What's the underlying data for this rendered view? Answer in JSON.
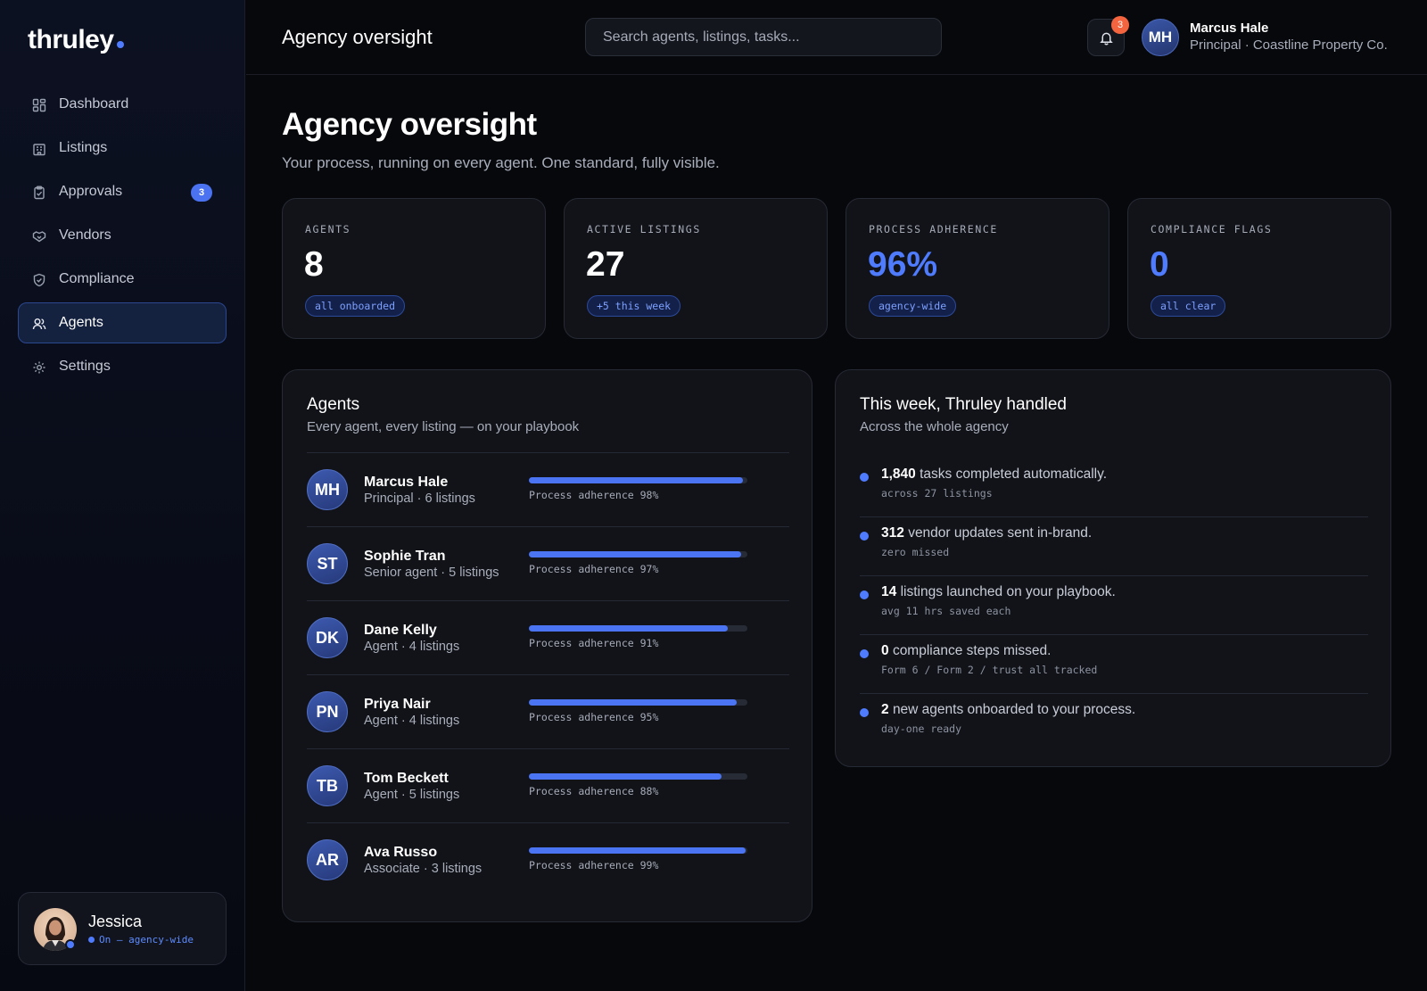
{
  "brand": {
    "name": "thruley"
  },
  "sidebar": {
    "items": [
      {
        "label": "Dashboard",
        "icon": "dashboard-icon"
      },
      {
        "label": "Listings",
        "icon": "building-icon"
      },
      {
        "label": "Approvals",
        "icon": "clipboard-icon",
        "badge": "3"
      },
      {
        "label": "Vendors",
        "icon": "handshake-icon"
      },
      {
        "label": "Compliance",
        "icon": "shield-icon"
      },
      {
        "label": "Agents",
        "icon": "users-icon",
        "active": true
      },
      {
        "label": "Settings",
        "icon": "gear-icon"
      }
    ],
    "assistant": {
      "name": "Jessica",
      "status": "On — agency-wide"
    }
  },
  "header": {
    "title": "Agency oversight",
    "search_placeholder": "Search agents, listings, tasks...",
    "notifications": "3",
    "user": {
      "initials": "MH",
      "name": "Marcus Hale",
      "role": "Principal · Coastline Property Co."
    }
  },
  "page": {
    "title": "Agency oversight",
    "subtitle": "Your process, running on every agent. One standard, fully visible."
  },
  "stats": [
    {
      "label": "AGENTS",
      "value": "8",
      "pill": "all onboarded"
    },
    {
      "label": "ACTIVE LISTINGS",
      "value": "27",
      "pill": "+5 this week"
    },
    {
      "label": "PROCESS ADHERENCE",
      "value": "96%",
      "pill": "agency-wide",
      "accent": true
    },
    {
      "label": "COMPLIANCE FLAGS",
      "value": "0",
      "pill": "all clear",
      "accent": true
    }
  ],
  "agents_panel": {
    "title": "Agents",
    "subtitle": "Every agent, every listing — on your playbook",
    "rows": [
      {
        "initials": "MH",
        "name": "Marcus Hale",
        "meta": "Principal · 6 listings",
        "adherence": 98,
        "label": "Process adherence 98%"
      },
      {
        "initials": "ST",
        "name": "Sophie Tran",
        "meta": "Senior agent · 5 listings",
        "adherence": 97,
        "label": "Process adherence 97%"
      },
      {
        "initials": "DK",
        "name": "Dane Kelly",
        "meta": "Agent · 4 listings",
        "adherence": 91,
        "label": "Process adherence 91%"
      },
      {
        "initials": "PN",
        "name": "Priya Nair",
        "meta": "Agent · 4 listings",
        "adherence": 95,
        "label": "Process adherence 95%"
      },
      {
        "initials": "TB",
        "name": "Tom Beckett",
        "meta": "Agent · 5 listings",
        "adherence": 88,
        "label": "Process adherence 88%"
      },
      {
        "initials": "AR",
        "name": "Ava Russo",
        "meta": "Associate · 3 listings",
        "adherence": 99,
        "label": "Process adherence 99%"
      }
    ]
  },
  "week_panel": {
    "title": "This week, Thruley handled",
    "subtitle": "Across the whole agency",
    "items": [
      {
        "value": "1,840",
        "text": "tasks completed automatically.",
        "sub": "across 27 listings"
      },
      {
        "value": "312",
        "text": "vendor updates sent in-brand.",
        "sub": "zero missed"
      },
      {
        "value": "14",
        "text": "listings launched on your playbook.",
        "sub": "avg 11 hrs saved each"
      },
      {
        "value": "0",
        "text": "compliance steps missed.",
        "sub": "Form 6 / Form 2 / trust all tracked"
      },
      {
        "value": "2",
        "text": "new agents onboarded to your process.",
        "sub": "day-one ready"
      }
    ]
  },
  "colors": {
    "accent": "#4f7cff",
    "badge_alert": "#f4653f",
    "background": "#07080c"
  }
}
